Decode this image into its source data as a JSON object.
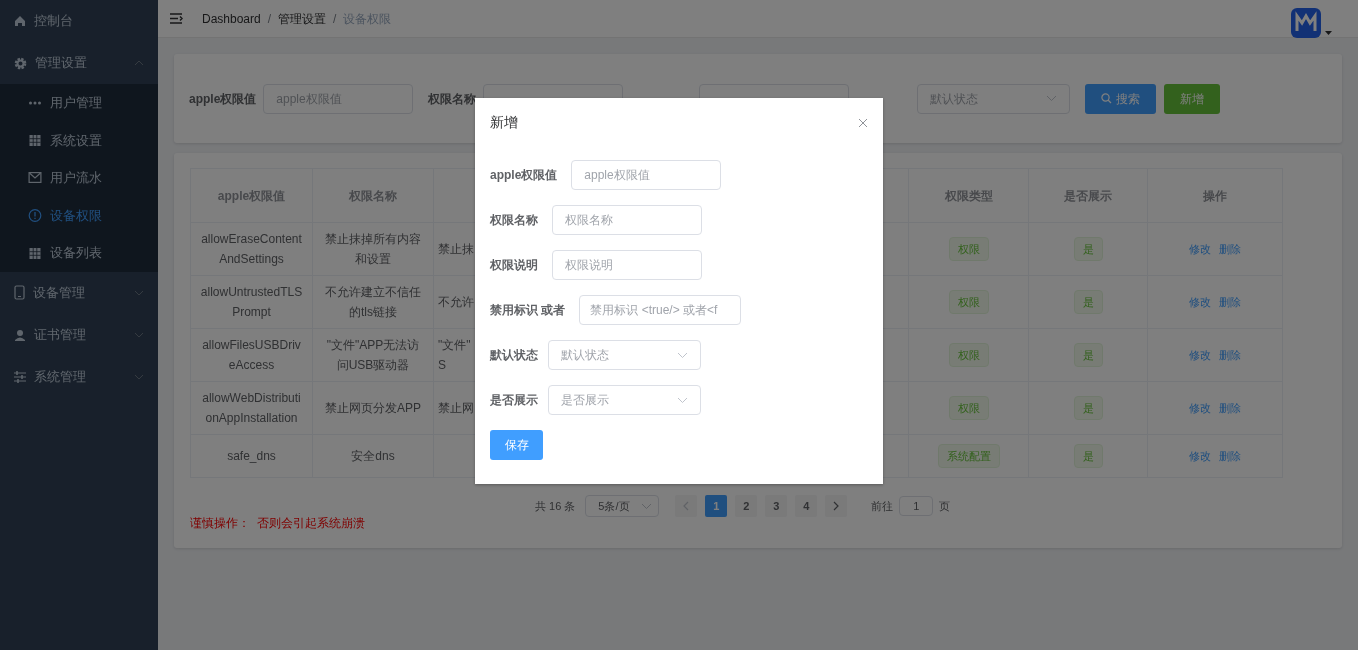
{
  "sidebar": {
    "items": [
      {
        "label": "控制台",
        "selected": false
      },
      {
        "label": "管理设置",
        "selected": false,
        "expanded": true,
        "children": [
          {
            "label": "用户管理",
            "selected": false
          },
          {
            "label": "系统设置",
            "selected": false
          },
          {
            "label": "用户流水",
            "selected": false
          },
          {
            "label": "设备权限",
            "selected": true
          },
          {
            "label": "设备列表",
            "selected": false
          }
        ]
      },
      {
        "label": "设备管理",
        "selected": false,
        "expanded": false
      },
      {
        "label": "证书管理",
        "selected": false,
        "expanded": false
      },
      {
        "label": "系统管理",
        "selected": false,
        "expanded": false
      }
    ]
  },
  "breadcrumb": {
    "items": [
      "Dashboard",
      "管理设置",
      "设备权限"
    ],
    "separators": [
      "/",
      "/"
    ]
  },
  "search_form": {
    "fields": [
      {
        "label": "apple权限值",
        "placeholder": "apple权限值",
        "kind": "input"
      },
      {
        "label": "权限名称",
        "kind": "input"
      },
      {
        "kind": "input"
      },
      {
        "placeholder": "默认状态",
        "kind": "select"
      }
    ],
    "buttons": [
      {
        "label": "搜索",
        "kind": "primary"
      },
      {
        "label": "新增",
        "kind": "success"
      }
    ]
  },
  "table": {
    "columns": [
      {
        "label": "apple权限值"
      },
      {
        "label": "权限名称"
      },
      {},
      {
        "label": "权限类型"
      },
      {
        "label": "是否展示"
      },
      {
        "label": "操作"
      }
    ],
    "rows": [
      {
        "apple_value": "allowEraseContentAndSettings",
        "name": "禁止抹掉所有内容和设置",
        "column_3": [
          "禁止抹"
        ],
        "type": "权限",
        "shown": "是",
        "actions": [
          "修改",
          "删除"
        ]
      },
      {
        "apple_value": "allowUntrustedTLSPrompt",
        "name": "不允许建立不信任的tls链接",
        "column_3": [
          "不允许"
        ],
        "type": "权限",
        "shown": "是",
        "actions": [
          "修改",
          "删除"
        ]
      },
      {
        "apple_value": "allowFilesUSBDriveAccess",
        "name": "\"文件\"APP无法访问USB驱动器",
        "column_3": [
          "\"文件\"",
          "S"
        ],
        "type": "权限",
        "shown": "是",
        "actions": [
          "修改",
          "删除"
        ]
      },
      {
        "apple_value": "allowWebDistributionAppInstallation",
        "name": "禁止网页分发APP",
        "column_3": [
          "禁止网"
        ],
        "type": "权限",
        "shown": "是",
        "actions": [
          "修改",
          "删除"
        ]
      },
      {
        "apple_value": "safe_dns",
        "name": "安全dns",
        "type": "系统配置",
        "shown": "是",
        "actions": [
          "修改",
          "删除"
        ]
      }
    ]
  },
  "pagination": {
    "total": "共 16 条",
    "page_size": "5条/页",
    "pages": [
      {
        "label": "1",
        "selected": true
      },
      {
        "label": "2",
        "selected": false
      },
      {
        "label": "3",
        "selected": false
      },
      {
        "label": "4",
        "selected": false
      }
    ],
    "goto_label": "前往",
    "goto_value": "1",
    "goto_suffix": "页"
  },
  "warning": "谨慎操作：  否则会引起系统崩溃",
  "modal": {
    "title": "新增",
    "fields": [
      {
        "label": "apple权限值",
        "placeholder": "apple权限值",
        "kind": "input"
      },
      {
        "label": "权限名称",
        "placeholder": "权限名称",
        "kind": "input"
      },
      {
        "label": "权限说明",
        "placeholder": "权限说明",
        "kind": "input"
      },
      {
        "label": "禁用标识 或者",
        "placeholder": "禁用标识 <true/> 或者<f",
        "kind": "input"
      },
      {
        "label": "默认状态",
        "placeholder": "默认状态",
        "kind": "select"
      },
      {
        "label": "是否展示",
        "placeholder": "是否展示",
        "kind": "select"
      }
    ],
    "save_button": "保存"
  }
}
